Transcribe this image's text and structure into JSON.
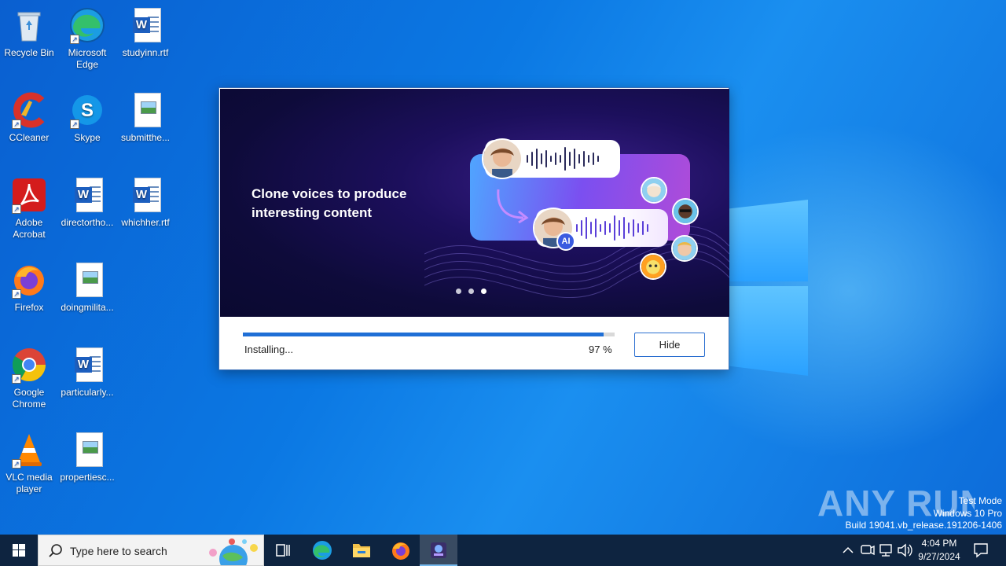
{
  "desktop": {
    "icons": [
      {
        "label": "Recycle Bin",
        "icon": "recycle-bin-icon"
      },
      {
        "label": "Microsoft Edge",
        "icon": "edge-icon"
      },
      {
        "label": "studyinn.rtf",
        "icon": "word-document-icon"
      },
      {
        "label": "CCleaner",
        "icon": "ccleaner-icon"
      },
      {
        "label": "Skype",
        "icon": "skype-icon"
      },
      {
        "label": "submitthe...",
        "icon": "image-file-icon"
      },
      {
        "label": "Adobe Acrobat",
        "icon": "acrobat-icon"
      },
      {
        "label": "directortho...",
        "icon": "word-document-icon"
      },
      {
        "label": "whichher.rtf",
        "icon": "word-document-icon"
      },
      {
        "label": "Firefox",
        "icon": "firefox-icon"
      },
      {
        "label": "doingmilita...",
        "icon": "image-file-icon"
      },
      {
        "label": "Google Chrome",
        "icon": "chrome-icon"
      },
      {
        "label": "particularly...",
        "icon": "word-document-icon"
      },
      {
        "label": "VLC media player",
        "icon": "vlc-icon"
      },
      {
        "label": "propertiesc...",
        "icon": "image-file-icon"
      }
    ]
  },
  "installer": {
    "banner_text": "Clone voices to produce interesting content",
    "ai_badge": "AI",
    "carousel_active_index": 2,
    "status": "Installing...",
    "progress_percent": 97,
    "percent_label": "97 %",
    "hide_label": "Hide",
    "accent": "#1f6fd6"
  },
  "watermark": {
    "brand": "ANY RUN",
    "test_mode": "Test Mode",
    "edition": "Windows 10 Pro",
    "build": "Build 19041.vb_release.191206-1406"
  },
  "taskbar": {
    "search_placeholder": "Type here to search",
    "pinned": [
      "task-view-icon",
      "edge-icon",
      "file-explorer-icon",
      "firefox-icon",
      "installer-app-icon"
    ],
    "time": "4:04 PM",
    "date": "9/27/2024",
    "tray_icons": [
      "chevron-up-icon",
      "meet-now-icon",
      "network-icon",
      "volume-icon"
    ]
  }
}
